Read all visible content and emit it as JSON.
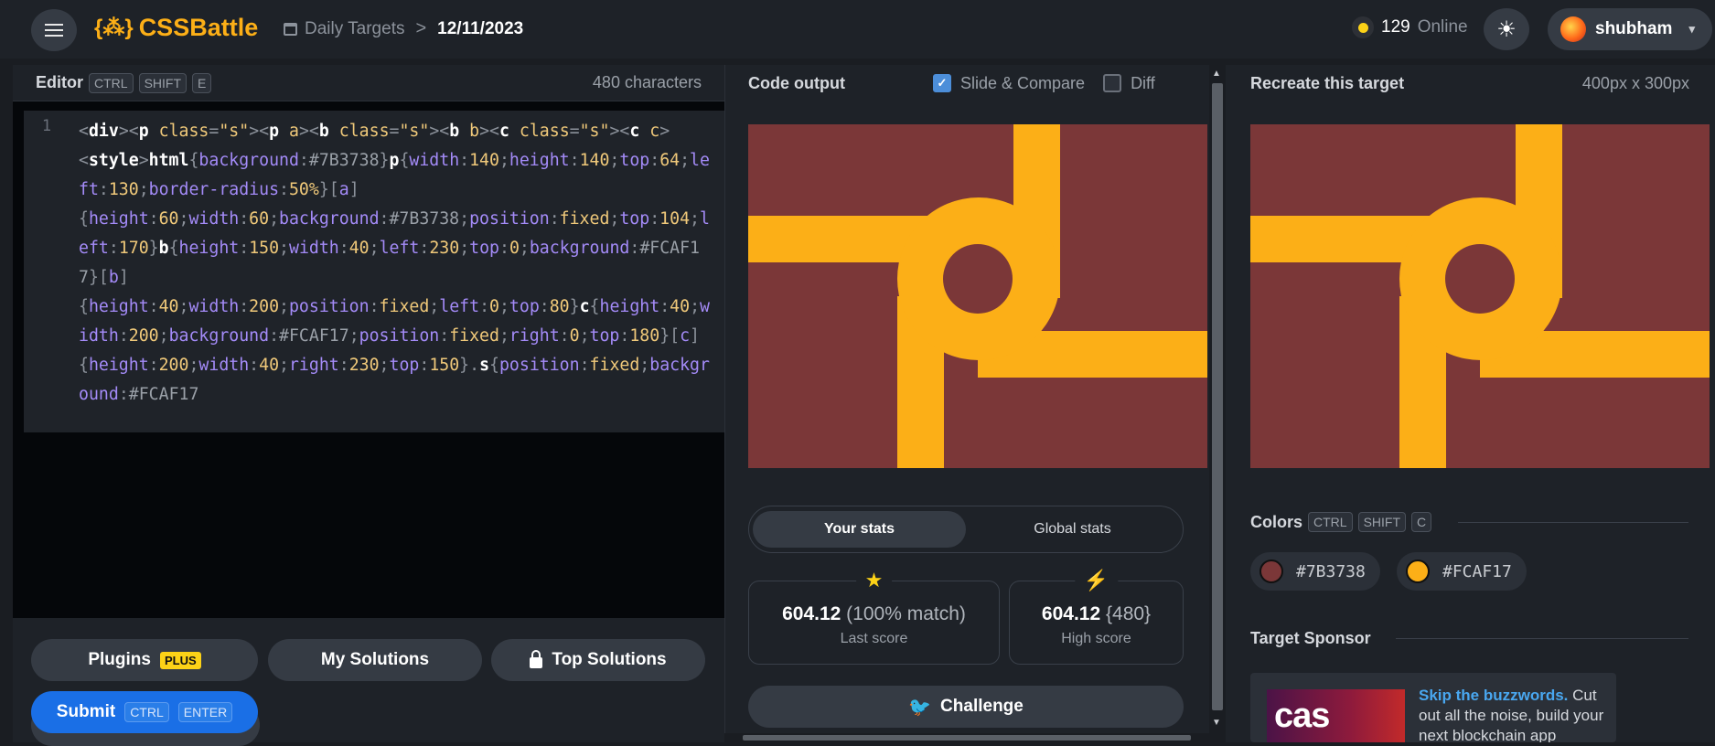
{
  "header": {
    "logo_text": "CSSBattle",
    "logo_mark": "{⁂}",
    "breadcrumb_link": "Daily Targets",
    "breadcrumb_sep": ">",
    "breadcrumb_current": "12/11/2023",
    "online_count": "129",
    "online_label": "Online",
    "theme_icon": "☀",
    "username": "shubham",
    "user_chevron": "▾"
  },
  "editor": {
    "title": "Editor",
    "shortcut": [
      "CTRL",
      "SHIFT",
      "E"
    ],
    "char_count": "480 characters",
    "line_number": "1"
  },
  "buttons": {
    "plugins": "Plugins",
    "plugins_badge": "PLUS",
    "my_solutions": "My Solutions",
    "top_solutions": "Top Solutions",
    "submit": "Submit",
    "submit_shortcut": [
      "CTRL",
      "ENTER"
    ]
  },
  "output": {
    "title": "Code output",
    "slide_compare": "Slide & Compare",
    "slide_compare_checked": true,
    "diff": "Diff",
    "diff_checked": false
  },
  "stats": {
    "tab_yours": "Your stats",
    "tab_global": "Global stats",
    "last_score_value": "604.12",
    "last_score_extra": "(100% match)",
    "last_score_label": "Last score",
    "high_score_value": "604.12",
    "high_score_extra": "{480}",
    "high_score_label": "High score",
    "challenge": "Challenge"
  },
  "target": {
    "title": "Recreate this target",
    "size": "400px x 300px",
    "colors_title": "Colors",
    "colors_shortcut": [
      "CTRL",
      "SHIFT",
      "C"
    ],
    "colors": [
      "#7B3738",
      "#FCAF17"
    ],
    "sponsor_title": "Target Sponsor",
    "sponsor_logo_text": "cas",
    "sponsor_headline": "Skip the buzzwords.",
    "sponsor_body": "Cut out all the noise, build your next blockchain app"
  },
  "palette": {
    "bg": "#7B3738",
    "fg": "#FCAF17",
    "accent_blue": "#1a6fe6"
  }
}
